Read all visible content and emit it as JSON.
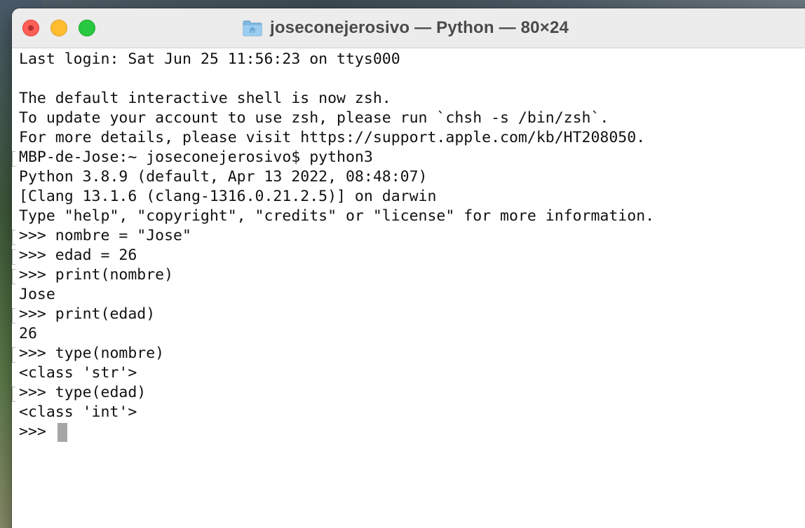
{
  "window": {
    "title": "joseconejerosivo — Python — 80×24",
    "folder_icon": "folder-home-icon",
    "buttons": [
      "close",
      "minimize",
      "zoom"
    ],
    "colors": {
      "close": "#ff5f57",
      "minimize": "#febc2e",
      "zoom": "#28c840",
      "cursor": "#a6a6a6"
    }
  },
  "terminal": {
    "lines": [
      "Last login: Sat Jun 25 11:56:23 on ttys000",
      "",
      "The default interactive shell is now zsh.",
      "To update your account to use zsh, please run `chsh -s /bin/zsh`.",
      "For more details, please visit https://support.apple.com/kb/HT208050.",
      "MBP-de-Jose:~ joseconejerosivo$ python3",
      "Python 3.8.9 (default, Apr 13 2022, 08:48:07)",
      "[Clang 13.1.6 (clang-1316.0.21.2.5)] on darwin",
      "Type \"help\", \"copyright\", \"credits\" or \"license\" for more information.",
      ">>> nombre = \"Jose\"",
      ">>> edad = 26",
      ">>> print(nombre)",
      "Jose",
      ">>> print(edad)",
      "26",
      ">>> type(nombre)",
      "<class 'str'>",
      ">>> type(edad)",
      "<class 'int'>",
      ">>> "
    ]
  }
}
